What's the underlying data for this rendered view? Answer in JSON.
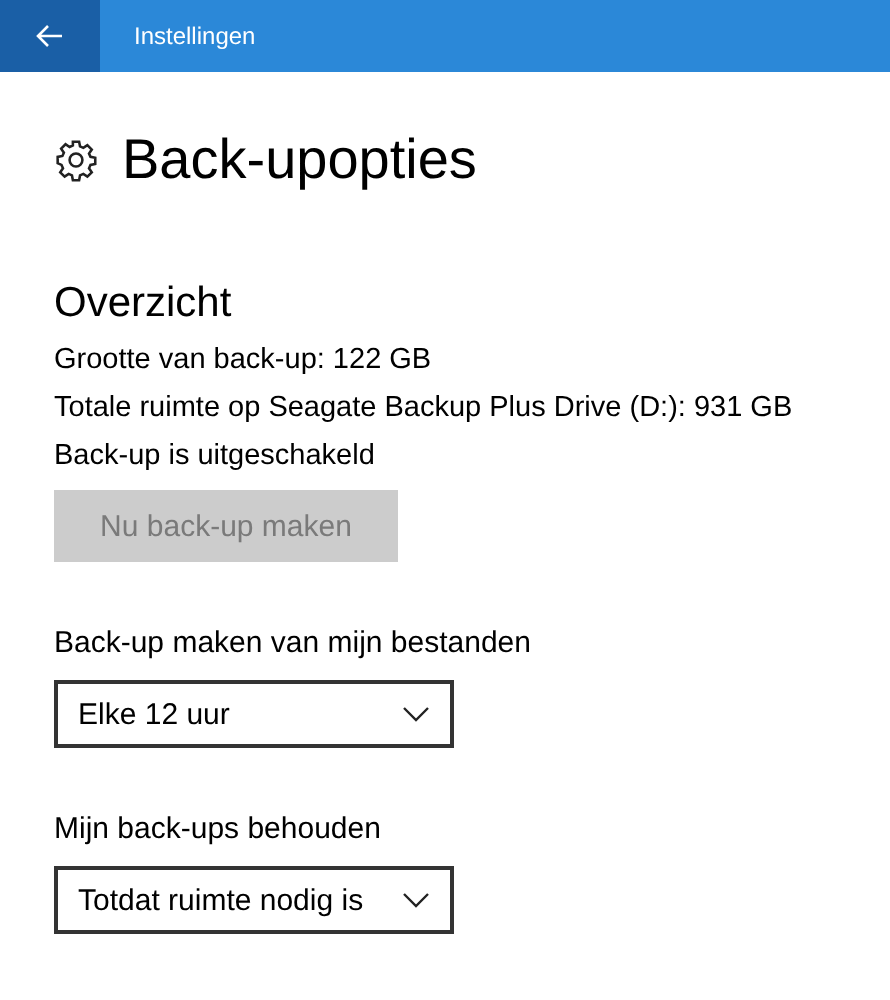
{
  "window": {
    "title": "Instellingen"
  },
  "page": {
    "title": "Back-upopties"
  },
  "overview": {
    "heading": "Overzicht",
    "lines": [
      "Grootte van back-up: 122 GB",
      "Totale ruimte op Seagate Backup Plus Drive (D:): 931 GB",
      "Back-up is uitgeschakeld"
    ],
    "button": {
      "label": "Nu back-up maken",
      "disabled": true
    }
  },
  "settings": [
    {
      "label": "Back-up maken van mijn bestanden",
      "value": "Elke 12 uur"
    },
    {
      "label": "Mijn back-ups behouden",
      "value": "Totdat ruimte nodig is"
    }
  ]
}
